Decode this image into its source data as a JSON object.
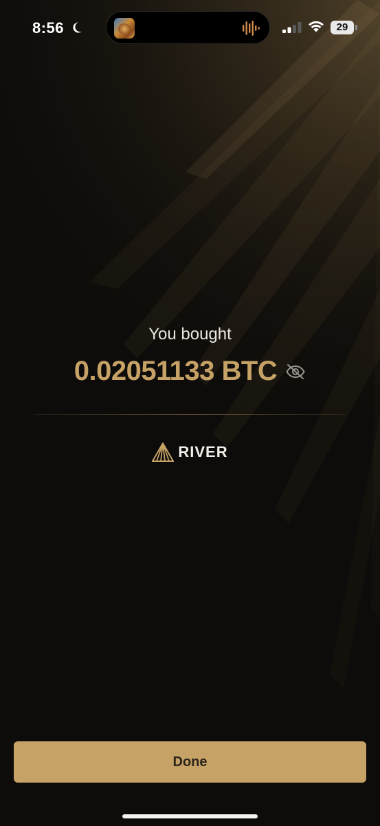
{
  "status_bar": {
    "time": "8:56",
    "battery": "29",
    "battery_percent": 29
  },
  "purchase": {
    "caption": "You bought",
    "amount": "0.02051133 BTC"
  },
  "brand": {
    "name": "RIVER"
  },
  "actions": {
    "done_label": "Done"
  },
  "icons": {
    "status": [
      "moon-icon",
      "waveform-icon",
      "signal-icon",
      "wifi-icon",
      "battery-icon"
    ],
    "content": [
      "eye-slash-icon",
      "river-logo-icon"
    ]
  },
  "colors": {
    "accent": "#c7a266",
    "background": "#0d0c0a",
    "button_text": "#2a2419",
    "waveform": "#d0894a"
  }
}
